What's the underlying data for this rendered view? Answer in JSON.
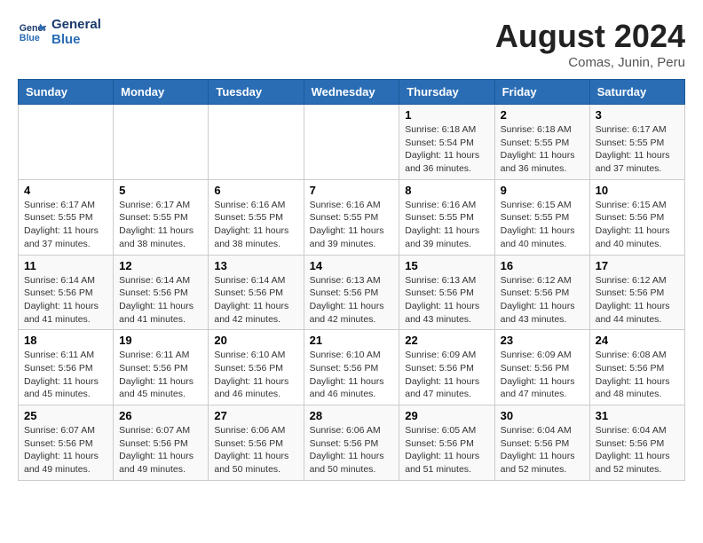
{
  "logo": {
    "line1": "General",
    "line2": "Blue"
  },
  "title": "August 2024",
  "location": "Comas, Junin, Peru",
  "days_of_week": [
    "Sunday",
    "Monday",
    "Tuesday",
    "Wednesday",
    "Thursday",
    "Friday",
    "Saturday"
  ],
  "weeks": [
    [
      {
        "day": "",
        "info": ""
      },
      {
        "day": "",
        "info": ""
      },
      {
        "day": "",
        "info": ""
      },
      {
        "day": "",
        "info": ""
      },
      {
        "day": "1",
        "info": "Sunrise: 6:18 AM\nSunset: 5:54 PM\nDaylight: 11 hours\nand 36 minutes."
      },
      {
        "day": "2",
        "info": "Sunrise: 6:18 AM\nSunset: 5:55 PM\nDaylight: 11 hours\nand 36 minutes."
      },
      {
        "day": "3",
        "info": "Sunrise: 6:17 AM\nSunset: 5:55 PM\nDaylight: 11 hours\nand 37 minutes."
      }
    ],
    [
      {
        "day": "4",
        "info": "Sunrise: 6:17 AM\nSunset: 5:55 PM\nDaylight: 11 hours\nand 37 minutes."
      },
      {
        "day": "5",
        "info": "Sunrise: 6:17 AM\nSunset: 5:55 PM\nDaylight: 11 hours\nand 38 minutes."
      },
      {
        "day": "6",
        "info": "Sunrise: 6:16 AM\nSunset: 5:55 PM\nDaylight: 11 hours\nand 38 minutes."
      },
      {
        "day": "7",
        "info": "Sunrise: 6:16 AM\nSunset: 5:55 PM\nDaylight: 11 hours\nand 39 minutes."
      },
      {
        "day": "8",
        "info": "Sunrise: 6:16 AM\nSunset: 5:55 PM\nDaylight: 11 hours\nand 39 minutes."
      },
      {
        "day": "9",
        "info": "Sunrise: 6:15 AM\nSunset: 5:55 PM\nDaylight: 11 hours\nand 40 minutes."
      },
      {
        "day": "10",
        "info": "Sunrise: 6:15 AM\nSunset: 5:56 PM\nDaylight: 11 hours\nand 40 minutes."
      }
    ],
    [
      {
        "day": "11",
        "info": "Sunrise: 6:14 AM\nSunset: 5:56 PM\nDaylight: 11 hours\nand 41 minutes."
      },
      {
        "day": "12",
        "info": "Sunrise: 6:14 AM\nSunset: 5:56 PM\nDaylight: 11 hours\nand 41 minutes."
      },
      {
        "day": "13",
        "info": "Sunrise: 6:14 AM\nSunset: 5:56 PM\nDaylight: 11 hours\nand 42 minutes."
      },
      {
        "day": "14",
        "info": "Sunrise: 6:13 AM\nSunset: 5:56 PM\nDaylight: 11 hours\nand 42 minutes."
      },
      {
        "day": "15",
        "info": "Sunrise: 6:13 AM\nSunset: 5:56 PM\nDaylight: 11 hours\nand 43 minutes."
      },
      {
        "day": "16",
        "info": "Sunrise: 6:12 AM\nSunset: 5:56 PM\nDaylight: 11 hours\nand 43 minutes."
      },
      {
        "day": "17",
        "info": "Sunrise: 6:12 AM\nSunset: 5:56 PM\nDaylight: 11 hours\nand 44 minutes."
      }
    ],
    [
      {
        "day": "18",
        "info": "Sunrise: 6:11 AM\nSunset: 5:56 PM\nDaylight: 11 hours\nand 45 minutes."
      },
      {
        "day": "19",
        "info": "Sunrise: 6:11 AM\nSunset: 5:56 PM\nDaylight: 11 hours\nand 45 minutes."
      },
      {
        "day": "20",
        "info": "Sunrise: 6:10 AM\nSunset: 5:56 PM\nDaylight: 11 hours\nand 46 minutes."
      },
      {
        "day": "21",
        "info": "Sunrise: 6:10 AM\nSunset: 5:56 PM\nDaylight: 11 hours\nand 46 minutes."
      },
      {
        "day": "22",
        "info": "Sunrise: 6:09 AM\nSunset: 5:56 PM\nDaylight: 11 hours\nand 47 minutes."
      },
      {
        "day": "23",
        "info": "Sunrise: 6:09 AM\nSunset: 5:56 PM\nDaylight: 11 hours\nand 47 minutes."
      },
      {
        "day": "24",
        "info": "Sunrise: 6:08 AM\nSunset: 5:56 PM\nDaylight: 11 hours\nand 48 minutes."
      }
    ],
    [
      {
        "day": "25",
        "info": "Sunrise: 6:07 AM\nSunset: 5:56 PM\nDaylight: 11 hours\nand 49 minutes."
      },
      {
        "day": "26",
        "info": "Sunrise: 6:07 AM\nSunset: 5:56 PM\nDaylight: 11 hours\nand 49 minutes."
      },
      {
        "day": "27",
        "info": "Sunrise: 6:06 AM\nSunset: 5:56 PM\nDaylight: 11 hours\nand 50 minutes."
      },
      {
        "day": "28",
        "info": "Sunrise: 6:06 AM\nSunset: 5:56 PM\nDaylight: 11 hours\nand 50 minutes."
      },
      {
        "day": "29",
        "info": "Sunrise: 6:05 AM\nSunset: 5:56 PM\nDaylight: 11 hours\nand 51 minutes."
      },
      {
        "day": "30",
        "info": "Sunrise: 6:04 AM\nSunset: 5:56 PM\nDaylight: 11 hours\nand 52 minutes."
      },
      {
        "day": "31",
        "info": "Sunrise: 6:04 AM\nSunset: 5:56 PM\nDaylight: 11 hours\nand 52 minutes."
      }
    ]
  ]
}
